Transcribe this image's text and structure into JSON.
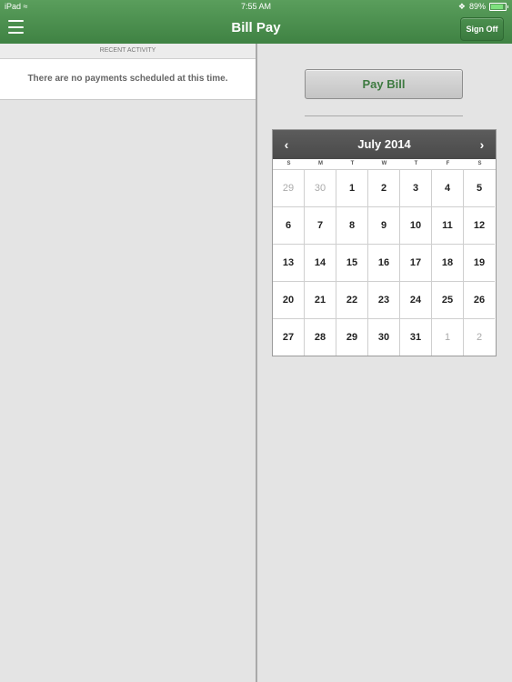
{
  "status_bar": {
    "device": "iPad",
    "time": "7:55 AM",
    "bluetooth": "bluetooth-icon",
    "battery_percent": "89%",
    "battery_level": 0.89
  },
  "header": {
    "title": "Bill Pay",
    "sign_off_label": "Sign Off",
    "menu_icon": "hamburger-icon"
  },
  "left": {
    "section_header": "RECENT ACTIVITY",
    "empty_message": "There are no payments scheduled at this time."
  },
  "right": {
    "pay_bill_label": "Pay Bill"
  },
  "calendar": {
    "month_label": "July 2014",
    "prev_glyph": "‹",
    "next_glyph": "›",
    "weekdays": [
      "S",
      "M",
      "T",
      "W",
      "T",
      "F",
      "S"
    ],
    "weeks": [
      [
        {
          "d": "29",
          "m": true
        },
        {
          "d": "30",
          "m": true
        },
        {
          "d": "1"
        },
        {
          "d": "2"
        },
        {
          "d": "3"
        },
        {
          "d": "4"
        },
        {
          "d": "5"
        }
      ],
      [
        {
          "d": "6"
        },
        {
          "d": "7"
        },
        {
          "d": "8"
        },
        {
          "d": "9"
        },
        {
          "d": "10"
        },
        {
          "d": "11"
        },
        {
          "d": "12"
        }
      ],
      [
        {
          "d": "13"
        },
        {
          "d": "14"
        },
        {
          "d": "15"
        },
        {
          "d": "16"
        },
        {
          "d": "17"
        },
        {
          "d": "18"
        },
        {
          "d": "19"
        }
      ],
      [
        {
          "d": "20"
        },
        {
          "d": "21"
        },
        {
          "d": "22"
        },
        {
          "d": "23"
        },
        {
          "d": "24"
        },
        {
          "d": "25"
        },
        {
          "d": "26"
        }
      ],
      [
        {
          "d": "27"
        },
        {
          "d": "28"
        },
        {
          "d": "29"
        },
        {
          "d": "30"
        },
        {
          "d": "31"
        },
        {
          "d": "1",
          "m": true
        },
        {
          "d": "2",
          "m": true
        }
      ]
    ]
  },
  "colors": {
    "header_green": "#4a8f4d",
    "pay_bill_text": "#3d7a40",
    "calendar_header": "#525252"
  }
}
